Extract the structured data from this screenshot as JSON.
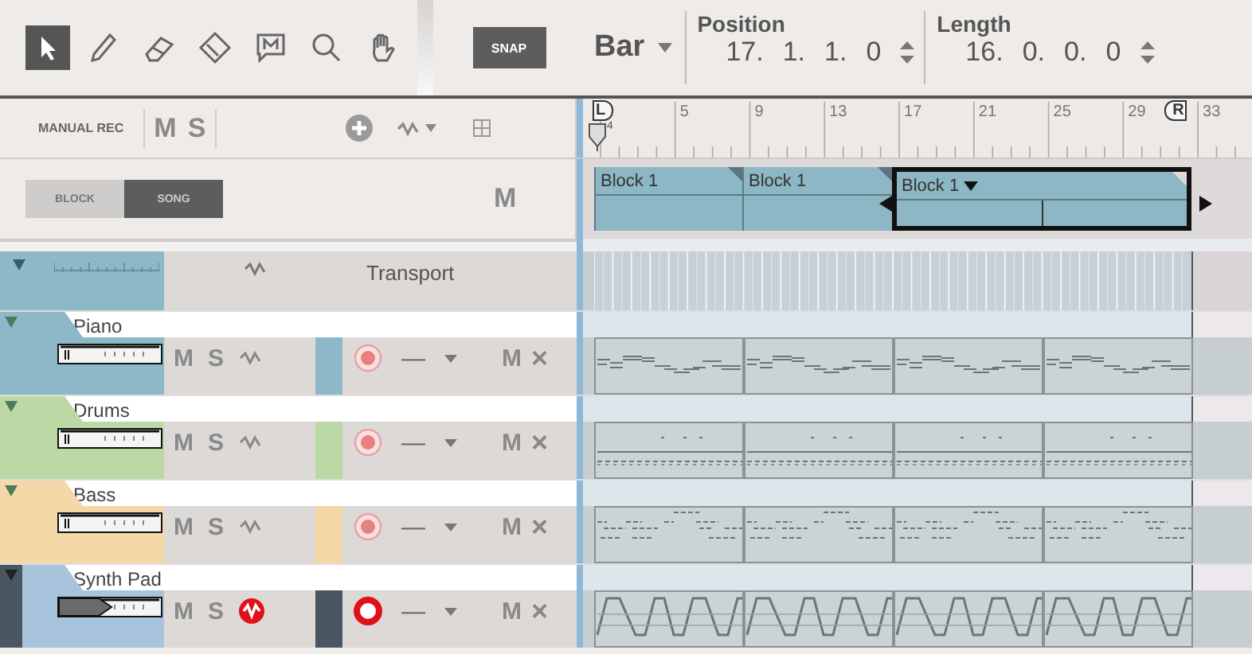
{
  "toolbar": {
    "tools": [
      {
        "kind": "arrow",
        "selected": true
      },
      {
        "kind": "pencil",
        "selected": false
      },
      {
        "kind": "eraser",
        "selected": false
      },
      {
        "kind": "glue",
        "selected": false
      },
      {
        "kind": "marker",
        "selected": false
      },
      {
        "kind": "zoom",
        "selected": false
      },
      {
        "kind": "hand",
        "selected": false
      }
    ],
    "snap": {
      "label": "SNAP",
      "on": true
    },
    "grid_unit": "Bar",
    "position": {
      "label": "Position",
      "values": [
        "17.",
        "1.",
        "1.",
        "0"
      ]
    },
    "length": {
      "label": "Length",
      "values": [
        "16.",
        "0.",
        "0.",
        "0"
      ]
    }
  },
  "track_header": {
    "manual_rec": "MANUAL REC",
    "mute": "M",
    "solo": "S"
  },
  "mode": {
    "buttons": [
      {
        "label": "BLOCK",
        "selected": false
      },
      {
        "label": "SONG",
        "selected": true
      }
    ],
    "mute": "M"
  },
  "ruler": {
    "left_locator": "L",
    "right_locator": "R",
    "playhead_label": "4",
    "labels": [
      "5",
      "9",
      "13",
      "17",
      "21",
      "25",
      "29",
      "33"
    ]
  },
  "blocks": [
    {
      "label": "Block 1",
      "selected": false
    },
    {
      "label": "Block 1",
      "selected": false
    },
    {
      "label": "Block 1",
      "selected": true
    }
  ],
  "transport": {
    "name": "Transport",
    "expanded": true
  },
  "tracks": [
    {
      "name": "Piano",
      "color": "#8cb8c8",
      "expanded": true,
      "selected": false,
      "armed": false,
      "automation_active": false,
      "kind": "melody",
      "mute": "M",
      "solo": "S",
      "mute_lane": "M",
      "delete": "×",
      "level_dash": "—"
    },
    {
      "name": "Drums",
      "color": "#bcd8a4",
      "expanded": true,
      "selected": false,
      "armed": false,
      "automation_active": false,
      "kind": "drums",
      "mute": "M",
      "solo": "S",
      "mute_lane": "M",
      "delete": "×",
      "level_dash": "—"
    },
    {
      "name": "Bass",
      "color": "#f4d8a8",
      "expanded": true,
      "selected": false,
      "armed": false,
      "automation_active": false,
      "kind": "bass",
      "mute": "M",
      "solo": "S",
      "mute_lane": "M",
      "delete": "×",
      "level_dash": "—"
    },
    {
      "name": "Synth Pad",
      "color": "#a8c4dc",
      "expanded": true,
      "selected": true,
      "armed": true,
      "automation_active": true,
      "kind": "wave",
      "mute": "M",
      "solo": "S",
      "mute_lane": "M",
      "delete": "×",
      "level_dash": "—"
    }
  ]
}
